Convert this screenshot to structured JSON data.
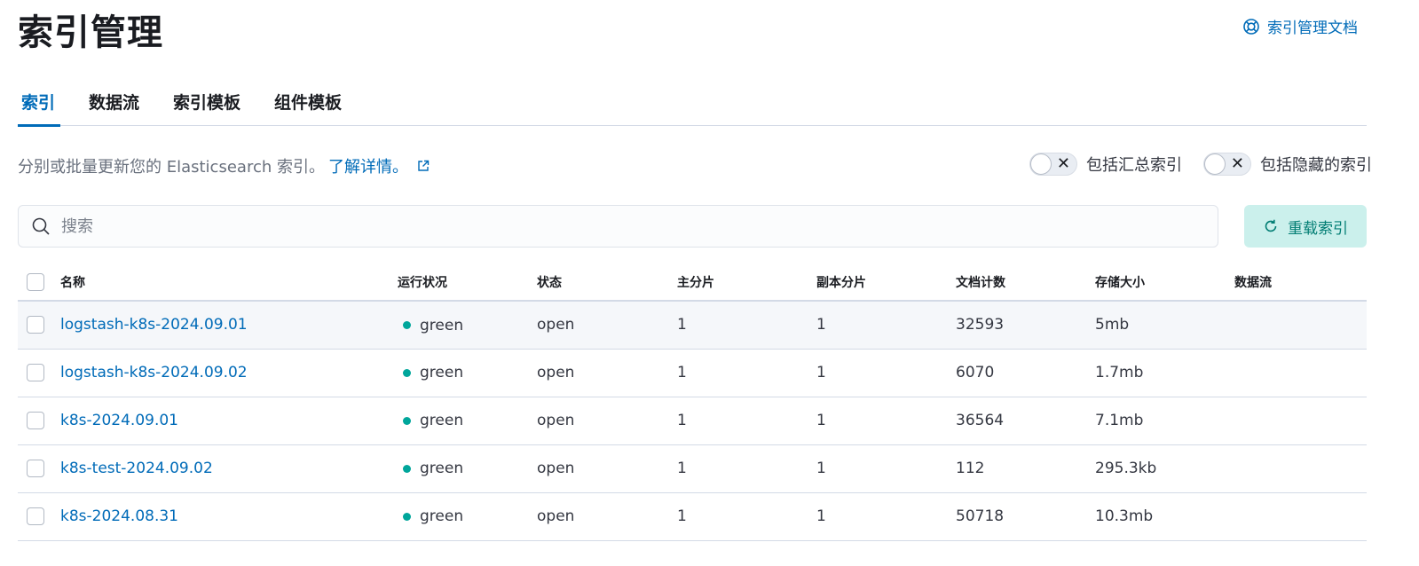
{
  "header": {
    "title": "索引管理",
    "docs_link": "索引管理文档"
  },
  "tabs": [
    {
      "label": "索引",
      "active": true
    },
    {
      "label": "数据流",
      "active": false
    },
    {
      "label": "索引模板",
      "active": false
    },
    {
      "label": "组件模板",
      "active": false
    }
  ],
  "description": {
    "text": "分别或批量更新您的 Elasticsearch 索引。",
    "link": "了解详情。"
  },
  "toggles": {
    "rollup_label": "包括汇总索引",
    "hidden_label": "包括隐藏的索引"
  },
  "search": {
    "placeholder": "搜索",
    "value": ""
  },
  "reload_button": "重载索引",
  "table": {
    "columns": [
      "名称",
      "运行状况",
      "状态",
      "主分片",
      "副本分片",
      "文档计数",
      "存储大小",
      "数据流"
    ],
    "rows": [
      {
        "name": "logstash-k8s-2024.09.01",
        "health": "green",
        "status": "open",
        "primary": "1",
        "replica": "1",
        "docs": "32593",
        "size": "5mb",
        "stream": ""
      },
      {
        "name": "logstash-k8s-2024.09.02",
        "health": "green",
        "status": "open",
        "primary": "1",
        "replica": "1",
        "docs": "6070",
        "size": "1.7mb",
        "stream": ""
      },
      {
        "name": "k8s-2024.09.01",
        "health": "green",
        "status": "open",
        "primary": "1",
        "replica": "1",
        "docs": "36564",
        "size": "7.1mb",
        "stream": ""
      },
      {
        "name": "k8s-test-2024.09.02",
        "health": "green",
        "status": "open",
        "primary": "1",
        "replica": "1",
        "docs": "112",
        "size": "295.3kb",
        "stream": ""
      },
      {
        "name": "k8s-2024.08.31",
        "health": "green",
        "status": "open",
        "primary": "1",
        "replica": "1",
        "docs": "50718",
        "size": "10.3mb",
        "stream": ""
      }
    ]
  },
  "colors": {
    "accent": "#006bb8",
    "health_green": "#00a69b",
    "reload_bg": "#cbf0ec",
    "reload_text": "#017d73"
  },
  "icons": {
    "docs": "help-lifebuoy-icon",
    "external": "external-link-icon",
    "search": "search-icon",
    "reload": "refresh-icon",
    "toggle_off": "close-icon"
  }
}
